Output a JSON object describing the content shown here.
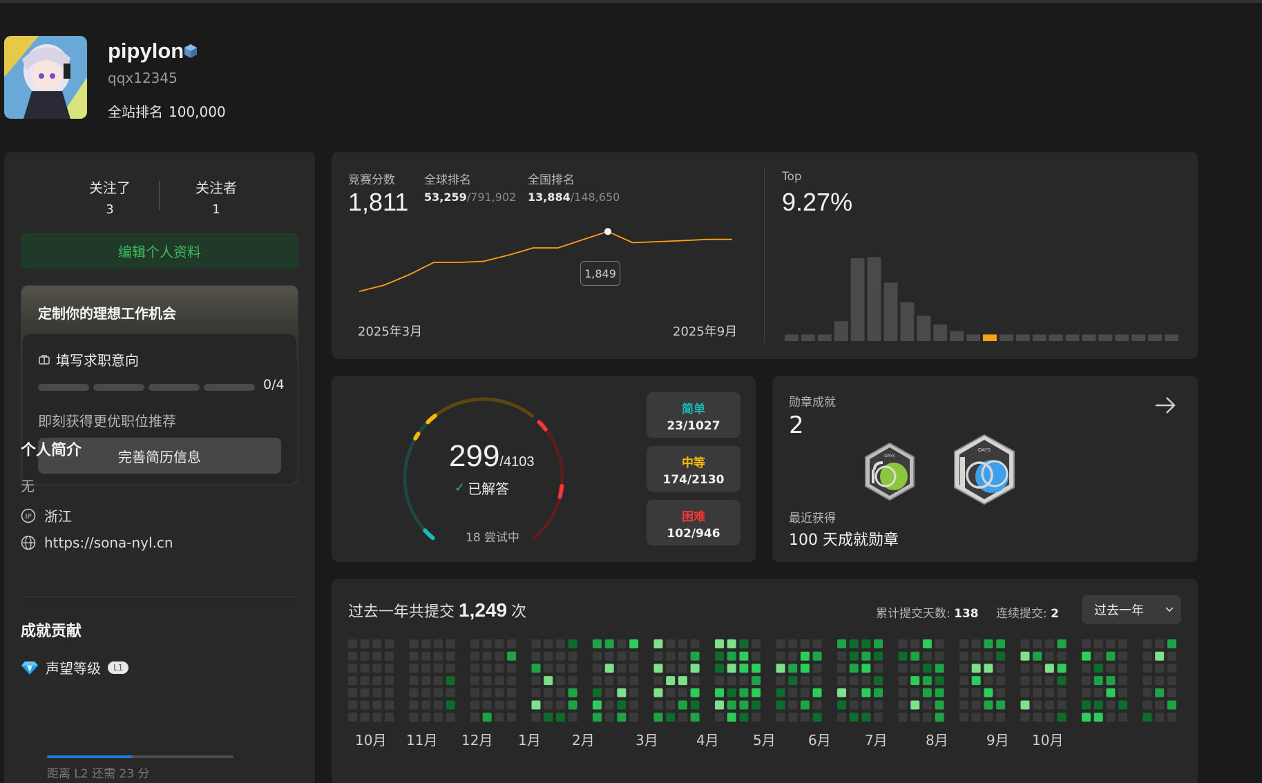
{
  "profile": {
    "name": "pipylon",
    "handle": "qqx12345",
    "rank_label": "全站排名",
    "rank_value": "100,000"
  },
  "follow": {
    "following_label": "关注了",
    "following_count": "3",
    "followers_label": "关注者",
    "followers_count": "1"
  },
  "edit_button": "编辑个人资料",
  "job": {
    "title": "定制你的理想工作机会",
    "row_label": "填写求职意向",
    "progress": "0/4",
    "progress_fraction": 0,
    "subtitle": "即刻获得更优职位推荐",
    "button": "完善简历信息"
  },
  "bio": {
    "title": "个人简介",
    "text": "无",
    "location": "浙江",
    "website": "https://sona-nyl.cn"
  },
  "achievements": {
    "title": "成就贡献",
    "reputation_label": "声望等级",
    "badge": "L1",
    "progress_fraction": 0.46,
    "note": "距离 L2 还需 23 分"
  },
  "contest": {
    "score_label": "竞赛分数",
    "score": "1,811",
    "global_label": "全球排名",
    "global_rank": "53,259",
    "global_total": "/791,902",
    "national_label": "全国排名",
    "national_rank": "13,884",
    "national_total": "/148,650",
    "x_start": "2025年3月",
    "x_end": "2025年9月",
    "tooltip": "1,849",
    "top_label": "Top",
    "top_value": "9.27%",
    "accent": "#ffa116"
  },
  "solved": {
    "count": "299",
    "total": "/4103",
    "label": "已解答",
    "attempting": "18 尝试中",
    "easy_label": "简单",
    "easy_value": "23/1027",
    "medium_label": "中等",
    "medium_value": "174/2130",
    "hard_label": "困难",
    "hard_value": "102/946",
    "colors": {
      "easy": "#1cbaba",
      "medium": "#ffb800",
      "hard": "#f63737"
    }
  },
  "badges": {
    "label": "勋章成就",
    "count": "2",
    "recent_label": "最近获得",
    "recent_name": "100 天成就勋章",
    "badge_text": "DAYS"
  },
  "heatmap": {
    "prefix": "过去一年共提交",
    "count": "1,249",
    "suffix": "次",
    "days_label": "累计提交天数:",
    "days_value": "138",
    "streak_label": "连续提交:",
    "streak_value": "2",
    "range": "过去一年",
    "months": [
      "10月",
      "11月",
      "12月",
      "1月",
      "2月",
      "3月",
      "4月",
      "5月",
      "6月",
      "7月",
      "8月",
      "9月",
      "10月"
    ]
  },
  "chart_data": [
    {
      "type": "line",
      "x": [
        "2025-03",
        "2025-03",
        "2025-04",
        "2025-04",
        "2025-05",
        "2025-05",
        "2025-06",
        "2025-06",
        "2025-06",
        "2025-07",
        "2025-07",
        "2025-07",
        "2025-08",
        "2025-08",
        "2025-09",
        "2025-09"
      ],
      "values": [
        1560,
        1590,
        1640,
        1700,
        1700,
        1705,
        1735,
        1770,
        1770,
        1810,
        1849,
        1795,
        1800,
        1805,
        1811,
        1811
      ],
      "ylim": [
        1500,
        1900
      ]
    },
    {
      "type": "bar",
      "highlight_index": 12,
      "values": [
        0.06,
        0.06,
        0.06,
        0.18,
        0.75,
        0.76,
        0.53,
        0.35,
        0.23,
        0.15,
        0.09,
        0.06,
        0.06,
        0.06,
        0.06,
        0.06,
        0.06,
        0.06,
        0.06,
        0.06,
        0.06,
        0.06,
        0.06,
        0.06
      ]
    }
  ]
}
